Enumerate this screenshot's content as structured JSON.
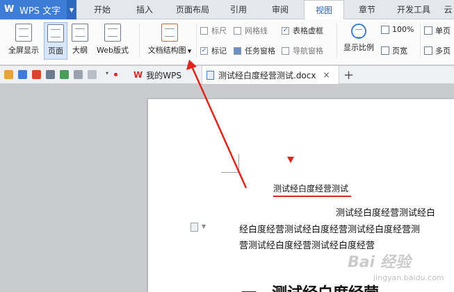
{
  "app": {
    "logo": "W",
    "name": "WPS 文字",
    "dropdown_icon": "caret-down-icon"
  },
  "menu_tabs": [
    "开始",
    "插入",
    "页面布局",
    "引用",
    "审阅",
    "视图",
    "章节",
    "开发工具",
    "云"
  ],
  "active_menu_tab": "视图",
  "ribbon": {
    "fullscreen": "全屏显示",
    "page": "页面",
    "outline": "大纲",
    "web": "Web版式",
    "doc_structure": "文档结构图",
    "ruler": "标尺",
    "gridlines": "网格线",
    "table_gridlines": "表格虚框",
    "marks": "标记",
    "task_pane": "任务窗格",
    "nav_pane": "导航窗格",
    "zoom": "显示比例",
    "zoom_100": "100%",
    "page_width": "页宽",
    "single_page": "单页",
    "multi_page": "多页"
  },
  "doc_tabs": {
    "my_wps": "我的WPS",
    "document": "测试经白度经营测试.docx",
    "close": "×",
    "new_tab": "+"
  },
  "document": {
    "title": "测试经白度经营测试",
    "line1": "测试经白度经营测试经白",
    "line2": "经白度经营测试经白度经营测试经白度经营测",
    "line3": "营测试经白度经营测试经白度经营",
    "heading": "一、测试经白度经营"
  },
  "watermark": {
    "brand": "Bai 经验",
    "url": "jingyan.baidu.com"
  },
  "colors": {
    "accent": "#3d7dd8",
    "annotation_red": "#e2231a"
  }
}
